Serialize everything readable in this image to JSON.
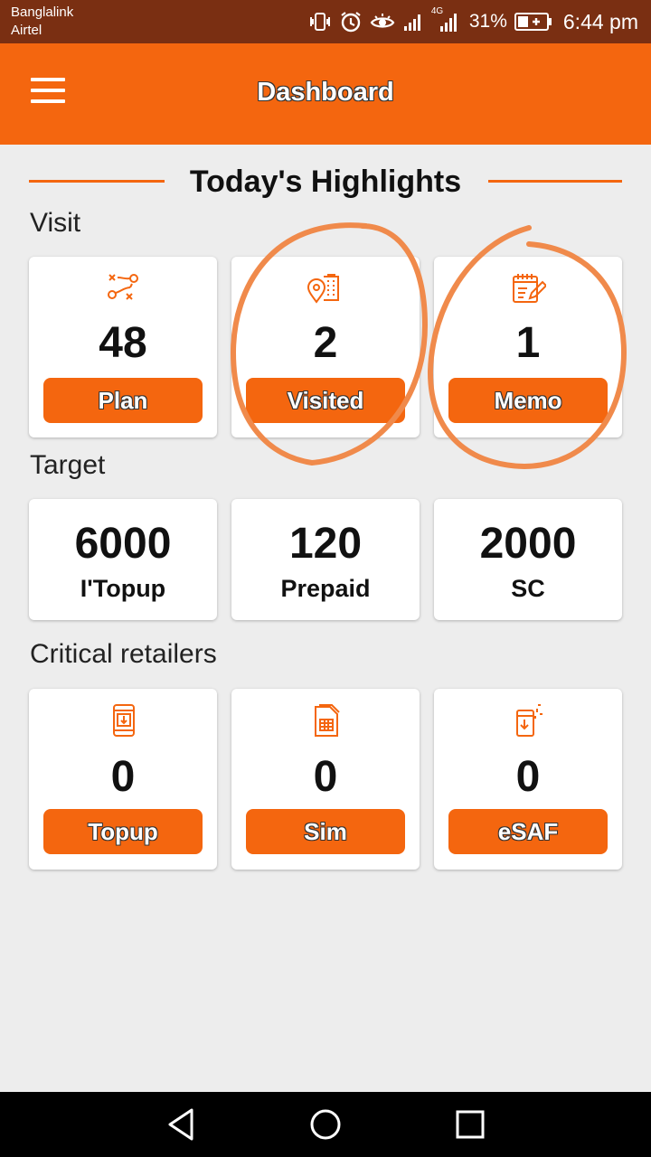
{
  "status_bar": {
    "carrier_1": "Banglalink",
    "carrier_2": "Airtel",
    "network_type": "4G",
    "battery_percent": "31%",
    "time": "6:44 pm",
    "icons": [
      "vibrate-icon",
      "alarm-icon",
      "eye-comfort-icon",
      "signal-icon",
      "signal-4g-icon",
      "battery-charging-icon"
    ]
  },
  "app_bar": {
    "title": "Dashboard",
    "menu_icon": "hamburger-menu-icon"
  },
  "highlights": {
    "title": "Today's Highlights"
  },
  "visit": {
    "label": "Visit",
    "cards": [
      {
        "icon": "route-plan-icon",
        "value": "48",
        "button": "Plan"
      },
      {
        "icon": "location-building-icon",
        "value": "2",
        "button": "Visited"
      },
      {
        "icon": "memo-notepad-icon",
        "value": "1",
        "button": "Memo"
      }
    ]
  },
  "target": {
    "label": "Target",
    "cards": [
      {
        "value": "6000",
        "caption": "I'Topup"
      },
      {
        "value": "120",
        "caption": "Prepaid"
      },
      {
        "value": "2000",
        "caption": "SC"
      }
    ]
  },
  "critical_retailers": {
    "label": "Critical retailers",
    "cards": [
      {
        "icon": "mobile-topup-icon",
        "value": "0",
        "button": "Topup"
      },
      {
        "icon": "sim-card-icon",
        "value": "0",
        "button": "Sim"
      },
      {
        "icon": "esaf-device-icon",
        "value": "0",
        "button": "eSAF"
      }
    ]
  },
  "nav_bar": {
    "icons": [
      "back-icon",
      "home-icon",
      "recents-icon"
    ]
  },
  "colors": {
    "accent": "#f4660f",
    "status_bar": "#7a2f12",
    "background": "#ededed",
    "annotation": "#f08a4b"
  }
}
